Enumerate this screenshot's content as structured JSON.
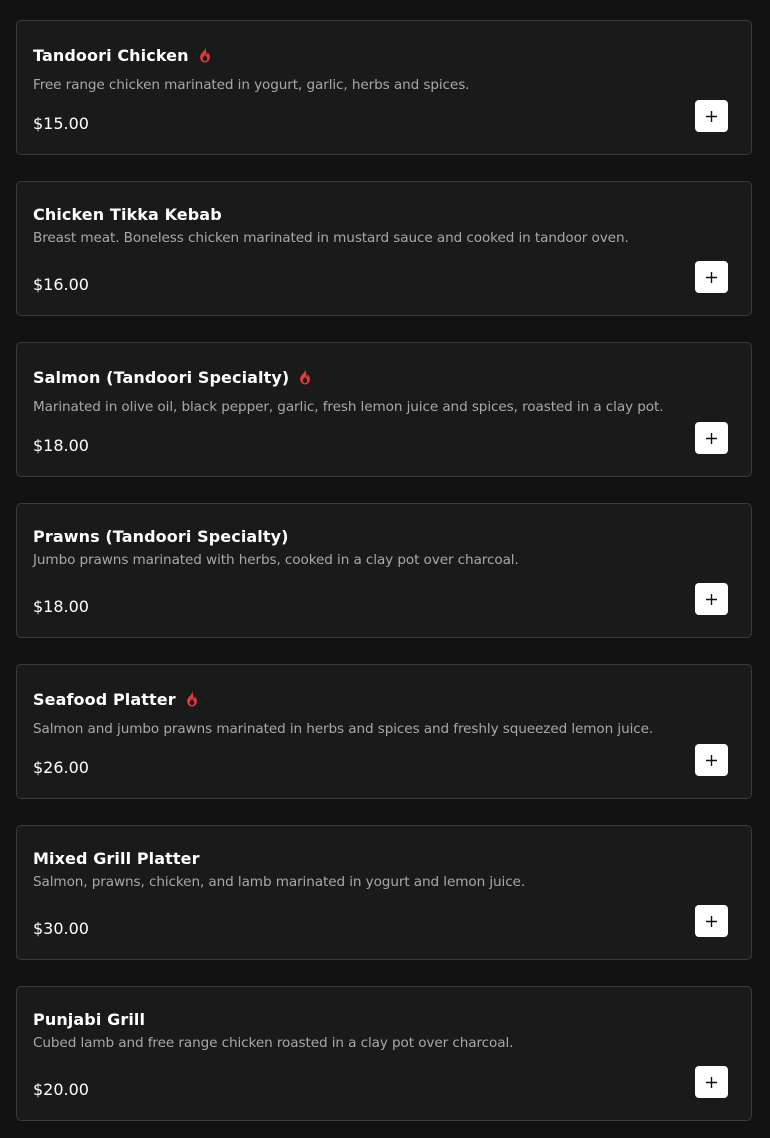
{
  "colors": {
    "background": "#121212",
    "card_background": "#1a1a1a",
    "card_border": "#3a3a3a",
    "title": "#ffffff",
    "description": "#a8a8a8",
    "spicy_icon": "#e53935",
    "add_button": "#ffffff"
  },
  "menu": {
    "items": [
      {
        "name": "Tandoori Chicken",
        "spicy": true,
        "description": "Free range chicken marinated in yogurt, garlic, herbs and spices.",
        "price": "$15.00",
        "add_icon": "plus-icon"
      },
      {
        "name": "Chicken Tikka Kebab",
        "spicy": false,
        "description": "Breast meat. Boneless chicken marinated in mustard sauce and cooked in tandoor oven.",
        "price": "$16.00",
        "add_icon": "plus-icon"
      },
      {
        "name": "Salmon (Tandoori Specialty)",
        "spicy": true,
        "description": "Marinated in olive oil, black pepper, garlic, fresh lemon juice and spices, roasted in a clay pot.",
        "price": "$18.00",
        "add_icon": "plus-icon"
      },
      {
        "name": "Prawns (Tandoori Specialty)",
        "spicy": false,
        "description": "Jumbo prawns marinated with herbs, cooked in a clay pot over charcoal.",
        "price": "$18.00",
        "add_icon": "plus-icon"
      },
      {
        "name": "Seafood Platter",
        "spicy": true,
        "description": "Salmon and jumbo prawns marinated in herbs and spices and freshly squeezed lemon juice.",
        "price": "$26.00",
        "add_icon": "plus-icon"
      },
      {
        "name": "Mixed Grill Platter",
        "spicy": false,
        "description": "Salmon, prawns, chicken, and lamb marinated in yogurt and lemon juice.",
        "price": "$30.00",
        "add_icon": "plus-icon"
      },
      {
        "name": "Punjabi Grill",
        "spicy": false,
        "description": "Cubed lamb and free range chicken roasted in a clay pot over charcoal.",
        "price": "$20.00",
        "add_icon": "plus-icon"
      }
    ]
  }
}
